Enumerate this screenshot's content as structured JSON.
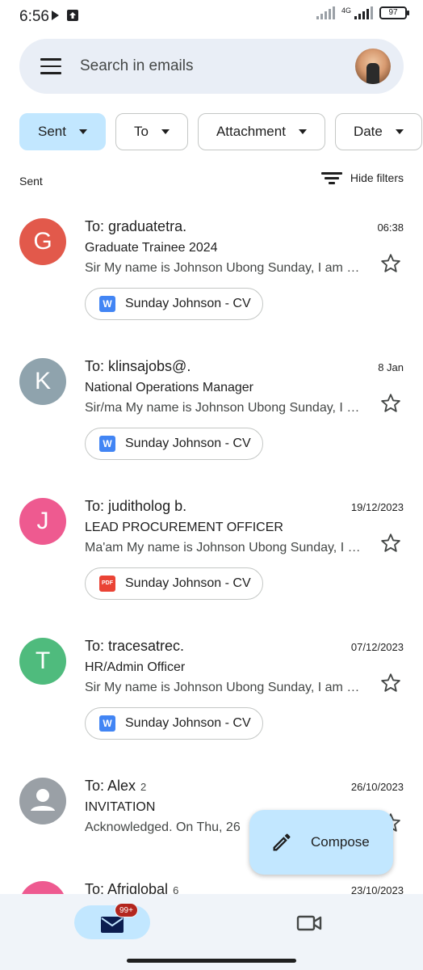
{
  "status_bar": {
    "time": "6:56",
    "network": "4G",
    "battery": "97"
  },
  "search": {
    "placeholder": "Search in emails"
  },
  "filters": {
    "chips": [
      {
        "label": "Sent",
        "active": true
      },
      {
        "label": "To",
        "active": false
      },
      {
        "label": "Attachment",
        "active": false
      },
      {
        "label": "Date",
        "active": false
      }
    ],
    "hide_filters_label": "Hide filters"
  },
  "section_label": "Sent",
  "emails": [
    {
      "avatar_letter": "G",
      "avatar_color": "#e2594b",
      "to": "To: graduatetra.",
      "count": "",
      "date": "06:38",
      "subject": "Graduate Trainee 2024",
      "snippet": "Sir My name is Johnson Ubong Sunday, I am a graduate of",
      "attachment": {
        "type": "word",
        "icon_text": "W",
        "name": "Sunday Johnson - CV"
      }
    },
    {
      "avatar_letter": "K",
      "avatar_color": "#8fa3ad",
      "to": "To: klinsajobs@.",
      "count": "",
      "date": "8 Jan",
      "subject": "National Operations Manager",
      "snippet": "Sir/ma My name is Johnson Ubong Sunday, I am a graduate",
      "attachment": {
        "type": "word",
        "icon_text": "W",
        "name": "Sunday Johnson - CV"
      }
    },
    {
      "avatar_letter": "J",
      "avatar_color": "#ee5a90",
      "to": "To: juditholog b.",
      "count": "",
      "date": "19/12/2023",
      "subject": "LEAD PROCUREMENT OFFICER",
      "snippet": "Ma'am My name is Johnson Ubong Sunday, I am a graduate",
      "attachment": {
        "type": "pdf",
        "icon_text": "PDF",
        "name": "Sunday Johnson - CV"
      }
    },
    {
      "avatar_letter": "T",
      "avatar_color": "#4fbb7d",
      "to": "To: tracesatrec.",
      "count": "",
      "date": "07/12/2023",
      "subject": "HR/Admin Officer",
      "snippet": "Sir My name is Johnson Ubong Sunday, I am a graduate of",
      "attachment": {
        "type": "word",
        "icon_text": "W",
        "name": "Sunday Johnson - CV"
      }
    },
    {
      "avatar_letter": "",
      "avatar_color": "#9aa0a6",
      "to": "To: Alex",
      "count": "2",
      "date": "26/10/2023",
      "subject": "INVITATION",
      "snippet": "Acknowledged. On Thu, 26",
      "attachment": null
    },
    {
      "avatar_letter": "",
      "avatar_color": "#ee5a90",
      "to": "To: Afriglobal",
      "count": "6",
      "date": "23/10/2023",
      "subject": "",
      "snippet": "",
      "attachment": null
    }
  ],
  "compose": {
    "label": "Compose"
  },
  "bottom_nav": {
    "mail_badge": "99+"
  }
}
